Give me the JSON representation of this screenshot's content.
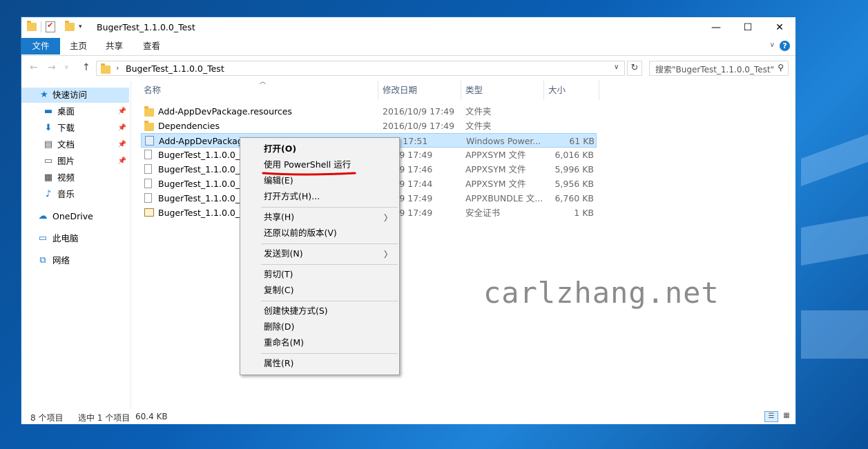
{
  "window": {
    "title": "BugerTest_1.1.0.0_Test"
  },
  "ribbon": {
    "tabs": [
      "文件",
      "主页",
      "共享",
      "查看"
    ]
  },
  "address": {
    "path": "BugerTest_1.1.0.0_Test",
    "search_placeholder": "搜索\"BugerTest_1.1.0.0_Test\""
  },
  "navpane": {
    "quick_access": "快速访问",
    "items": [
      "桌面",
      "下载",
      "文档",
      "图片",
      "视频",
      "音乐"
    ],
    "onedrive": "OneDrive",
    "this_pc": "此电脑",
    "network": "网络"
  },
  "columns": [
    "名称",
    "修改日期",
    "类型",
    "大小"
  ],
  "files": [
    {
      "name": "Add-AppDevPackage.resources",
      "date": "2016/10/9 17:49",
      "type": "文件夹",
      "size": "",
      "icon": "folder-icon"
    },
    {
      "name": "Dependencies",
      "date": "2016/10/9 17:49",
      "type": "文件夹",
      "size": "",
      "icon": "folder-icon"
    },
    {
      "name": "Add-AppDevPackage",
      "date": "/7/6 17:51",
      "type": "Windows Power...",
      "size": "61 KB",
      "icon": "powershell-script-icon"
    },
    {
      "name": "BugerTest_1.1.0.0_AR",
      "date": "/10/9 17:49",
      "type": "APPXSYM 文件",
      "size": "6,016 KB",
      "icon": "file-icon"
    },
    {
      "name": "BugerTest_1.1.0.0_x6",
      "date": "/10/9 17:46",
      "type": "APPXSYM 文件",
      "size": "5,996 KB",
      "icon": "file-icon"
    },
    {
      "name": "BugerTest_1.1.0.0_x8",
      "date": "/10/9 17:44",
      "type": "APPXSYM 文件",
      "size": "5,956 KB",
      "icon": "file-icon"
    },
    {
      "name": "BugerTest_1.1.0.0_x8",
      "date": "/10/9 17:49",
      "type": "APPXBUNDLE 文...",
      "size": "6,760 KB",
      "icon": "file-icon"
    },
    {
      "name": "BugerTest_1.1.0.0_x8",
      "date": "/10/9 17:49",
      "type": "安全证书",
      "size": "1 KB",
      "icon": "certificate-icon"
    }
  ],
  "context_menu": {
    "open": "打开(O)",
    "run_powershell": "使用 PowerShell 运行",
    "edit": "编辑(E)",
    "open_with": "打开方式(H)...",
    "share": "共享(H)",
    "restore": "还原以前的版本(V)",
    "send_to": "发送到(N)",
    "cut": "剪切(T)",
    "copy": "复制(C)",
    "create_shortcut": "创建快捷方式(S)",
    "delete": "删除(D)",
    "rename": "重命名(M)",
    "properties": "属性(R)"
  },
  "status": {
    "count": "8 个项目",
    "selected": "选中 1 个项目",
    "size": "60.4 KB"
  },
  "watermark": "carlzhang.net",
  "colors": {
    "accent": "#1979ca",
    "selection": "#cce8ff",
    "underline": "#e00000"
  }
}
